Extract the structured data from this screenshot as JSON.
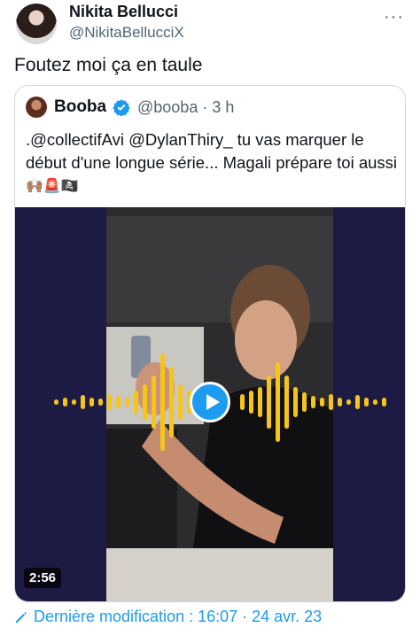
{
  "tweet": {
    "author_name": "Nikita Bellucci",
    "author_handle": "@NikitaBellucciX",
    "text": "Foutez moi ça en taule",
    "more_label": "···"
  },
  "quoted": {
    "author_name": "Booba",
    "author_handle": "@booba · 3 h",
    "text": ".@collectifAvi @DylanThiry_ tu vas marquer le début d'une longue série... Magali prépare toi aussi",
    "emojis": "🙌🏽🚨🏴‍☠️",
    "video": {
      "duration": "2:56"
    }
  },
  "footer": {
    "edited_label": "Dernière modification : 16:07 · 24 avr. 23"
  },
  "colors": {
    "accent": "#1d9bf0",
    "wave": "#f5c518",
    "media_bg": "#1d1b44"
  }
}
